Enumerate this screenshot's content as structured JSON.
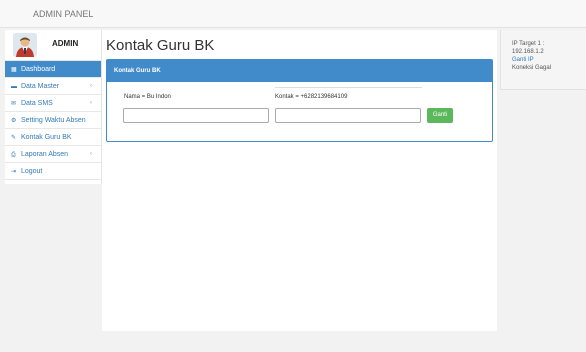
{
  "topbar": {
    "brand": "ADMIN PANEL"
  },
  "sidebar": {
    "profile_name": "ADMIN",
    "items": [
      {
        "label": "Dashboard",
        "icon": "▦",
        "icon_name": "dashboard-icon",
        "active": true
      },
      {
        "label": "Data Master",
        "icon": "▬",
        "icon_name": "folder-icon",
        "chevron": "‹"
      },
      {
        "label": "Data SMS",
        "icon": "✉",
        "icon_name": "mail-icon",
        "chevron": "‹"
      },
      {
        "label": "Setting Waktu Absen",
        "icon": "⚙",
        "icon_name": "gear-icon"
      },
      {
        "label": "Kontak Guru BK",
        "icon": "✎",
        "icon_name": "edit-icon"
      },
      {
        "label": "Laporan Absen",
        "icon": "⎙",
        "icon_name": "print-icon",
        "chevron": "‹"
      },
      {
        "label": "Logout",
        "icon": "⇥",
        "icon_name": "logout-icon"
      }
    ]
  },
  "main": {
    "title": "Kontak Guru BK",
    "panel_heading": "Kontak Guru BK",
    "contact_name": "Nama = Bu Indon",
    "contact_phone": "Kontak = +6282139684109",
    "button_label": "Ganti"
  },
  "right_panel": {
    "lines": [
      {
        "text": "IP Target 1 :",
        "link": false
      },
      {
        "text": "192.168.1.2",
        "link": false
      },
      {
        "text": "Ganti IP",
        "link": true
      },
      {
        "text": "Koneksi Gagal",
        "link": false
      }
    ]
  },
  "colors": {
    "primary": "#428bca",
    "success": "#5cb85c"
  }
}
